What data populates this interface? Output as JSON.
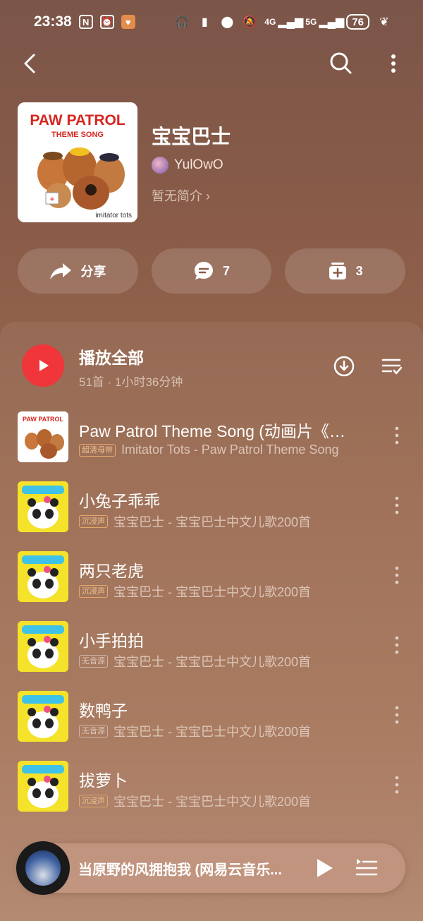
{
  "status_bar": {
    "time": "23:38",
    "network_left": "4G",
    "network_right": "5G",
    "battery": "76"
  },
  "playlist": {
    "title": "宝宝巴士",
    "creator": "YulOwO",
    "intro": "暂无简介 ›",
    "cover_text": {
      "title_line1": "PAW PATROL",
      "title_line2": "THEME SONG",
      "footer": "imitator tots"
    }
  },
  "actions": {
    "share_label": "分享",
    "comment_count": "7",
    "collect_count": "3"
  },
  "play_all": {
    "label": "播放全部",
    "meta": "51首 · 1小时36分钟"
  },
  "songs": [
    {
      "title": "Paw Patrol Theme Song (动画片《汪汪队立大功》主题曲)",
      "badge": "超清母带",
      "artist": "Imitator Tots - Paw Patrol Theme Song",
      "thumb": "paw-patrol",
      "badge_style": "orange"
    },
    {
      "title": "小兔子乖乖",
      "badge": "沉浸声",
      "artist": "宝宝巴士 - 宝宝巴士中文儿歌200首",
      "thumb": "babybus",
      "badge_style": "orange"
    },
    {
      "title": "两只老虎",
      "badge": "沉浸声",
      "artist": "宝宝巴士 - 宝宝巴士中文儿歌200首",
      "thumb": "babybus",
      "badge_style": "orange"
    },
    {
      "title": "小手拍拍",
      "badge": "无音源",
      "artist": "宝宝巴士 - 宝宝巴士中文儿歌200首",
      "thumb": "babybus",
      "badge_style": "gray"
    },
    {
      "title": "数鸭子",
      "badge": "无音源",
      "artist": "宝宝巴士 - 宝宝巴士中文儿歌200首",
      "thumb": "babybus",
      "badge_style": "gray"
    },
    {
      "title": "拔萝卜",
      "badge": "沉浸声",
      "artist": "宝宝巴士 - 宝宝巴士中文儿歌200首",
      "thumb": "babybus",
      "badge_style": "orange"
    }
  ],
  "now_playing": {
    "title": "当原野的风拥抱我 (网易云音乐..."
  },
  "colors": {
    "accent_red": "#f0363a",
    "badge_orange": "#e6a76a"
  }
}
